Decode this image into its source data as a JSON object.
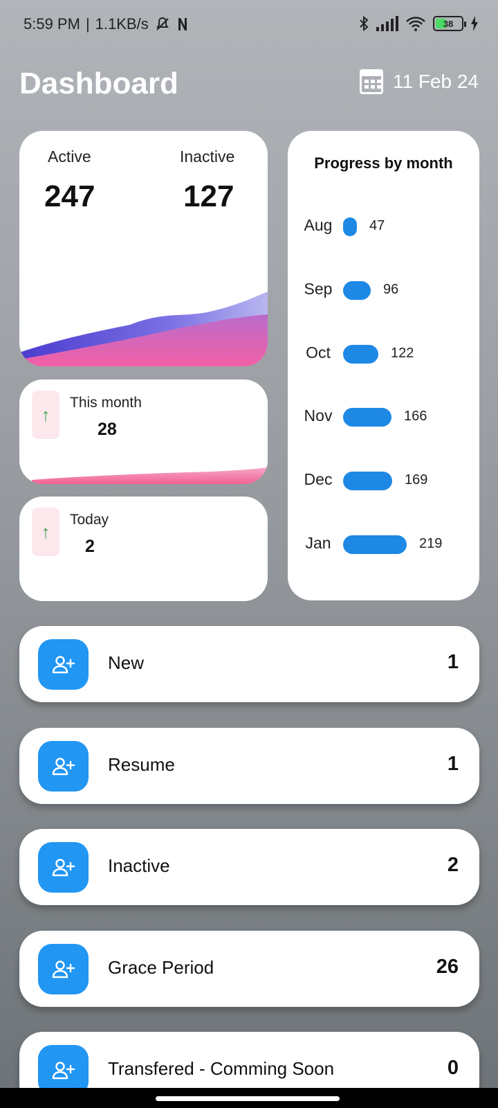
{
  "status_bar": {
    "time": "5:59 PM",
    "separator": "|",
    "speed": "1.1KB/s",
    "battery": "38",
    "icons": [
      "bell-off-icon",
      "n-notification-icon",
      "bluetooth-icon",
      "signal-icon",
      "wifi-icon",
      "battery-icon",
      "charging-icon"
    ]
  },
  "header": {
    "title": "Dashboard",
    "date": "11 Feb 24",
    "icon": "calendar-icon"
  },
  "stats": {
    "active_label": "Active",
    "active_value": "247",
    "inactive_label": "Inactive",
    "inactive_value": "127"
  },
  "this_month": {
    "label": "This month",
    "value": "28",
    "icon": "arrow-up-icon"
  },
  "today": {
    "label": "Today",
    "value": "2",
    "icon": "arrow-up-icon"
  },
  "progress": {
    "title": "Progress by month",
    "max": 219,
    "rows": [
      {
        "month": "Aug",
        "value": 47
      },
      {
        "month": "Sep",
        "value": 96
      },
      {
        "month": "Oct",
        "value": 122
      },
      {
        "month": "Nov",
        "value": 166
      },
      {
        "month": "Dec",
        "value": 169
      },
      {
        "month": "Jan",
        "value": 219
      }
    ]
  },
  "list": [
    {
      "label": "New",
      "count": "1",
      "icon": "add-user-icon"
    },
    {
      "label": "Resume",
      "count": "1",
      "icon": "add-user-icon"
    },
    {
      "label": "Inactive",
      "count": "2",
      "icon": "add-user-icon"
    },
    {
      "label": "Grace Period",
      "count": "26",
      "icon": "add-user-icon"
    },
    {
      "label": "Transfered - Comming Soon",
      "count": "0",
      "icon": "add-user-icon"
    }
  ],
  "colors": {
    "accent": "#2196f3",
    "bar": "#1e88e5",
    "wave_purple": "#6a5ae0",
    "wave_pink": "#f06292",
    "up_arrow": "#3aa34b"
  }
}
